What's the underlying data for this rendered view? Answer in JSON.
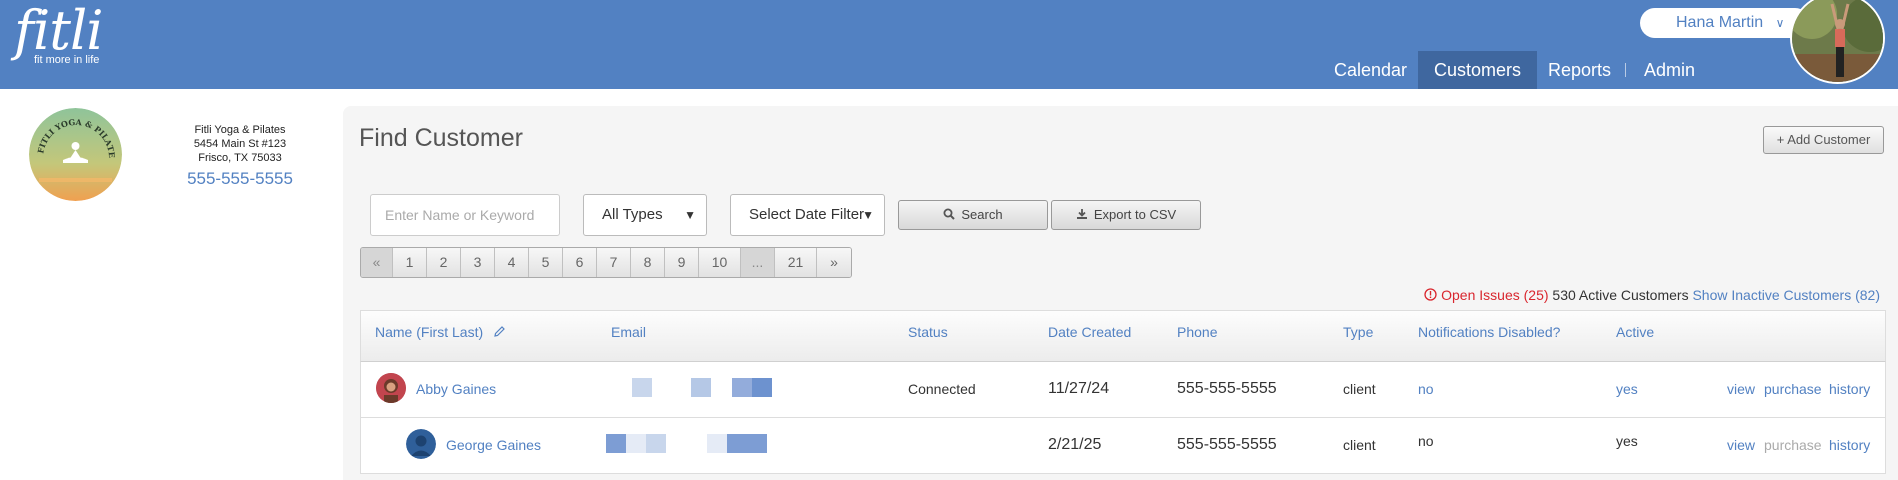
{
  "app": {
    "logo_text": "fitli",
    "logo_tagline": "fit more in life"
  },
  "user": {
    "name": "Hana Martin"
  },
  "nav": [
    {
      "label": "Calendar",
      "active": false
    },
    {
      "label": "Customers",
      "active": true
    },
    {
      "label": "Reports",
      "active": false
    },
    {
      "label": "Admin",
      "active": false
    }
  ],
  "business": {
    "logo_text": "FITLI YOGA & PILATES",
    "name": "Fitli Yoga & Pilates",
    "address1": "5454 Main St #123",
    "address2": "Frisco, TX 75033",
    "phone": "555-555-5555"
  },
  "page": {
    "title": "Find Customer",
    "add_button": "+ Add Customer"
  },
  "filters": {
    "search_placeholder": "Enter Name or Keyword",
    "type_select": "All Types",
    "date_select": "Select Date Filter",
    "search_button": "Search",
    "export_button": "Export to CSV"
  },
  "pager": {
    "first": "«",
    "pages": [
      "1",
      "2",
      "3",
      "4",
      "5",
      "6",
      "7",
      "8",
      "9",
      "10"
    ],
    "ellipsis": "...",
    "last_page": "21",
    "next": "»"
  },
  "summary": {
    "open_issues": "Open Issues (25)",
    "active": "530 Active Customers",
    "inactive_link": "Show Inactive Customers (82)"
  },
  "table": {
    "columns": [
      "Name (First Last)",
      "Email",
      "Status",
      "Date Created",
      "Phone",
      "Type",
      "Notifications Disabled?",
      "Active"
    ],
    "rows": [
      {
        "name": "Abby Gaines",
        "status": "Connected",
        "date": "11/27/24",
        "phone": "555-555-5555",
        "type": "client",
        "notifications": "no",
        "active": "yes",
        "actions": [
          "view",
          "purchase",
          "history"
        ]
      },
      {
        "name": "George Gaines",
        "status": "",
        "date": "2/21/25",
        "phone": "555-555-5555",
        "type": "client",
        "notifications": "no",
        "active": "yes",
        "actions": [
          "view",
          "purchase",
          "history"
        ]
      }
    ]
  },
  "colors": {
    "header_blue": "#5281c2",
    "active_tab": "#3f679f",
    "link": "#5281c2",
    "alert_red": "#d9262e",
    "panel_bg": "#f5f5f5"
  },
  "icons": [
    "chevron-down-icon",
    "pencil-icon",
    "search-icon",
    "download-icon",
    "alert-circle-icon",
    "caret-down-icon"
  ]
}
